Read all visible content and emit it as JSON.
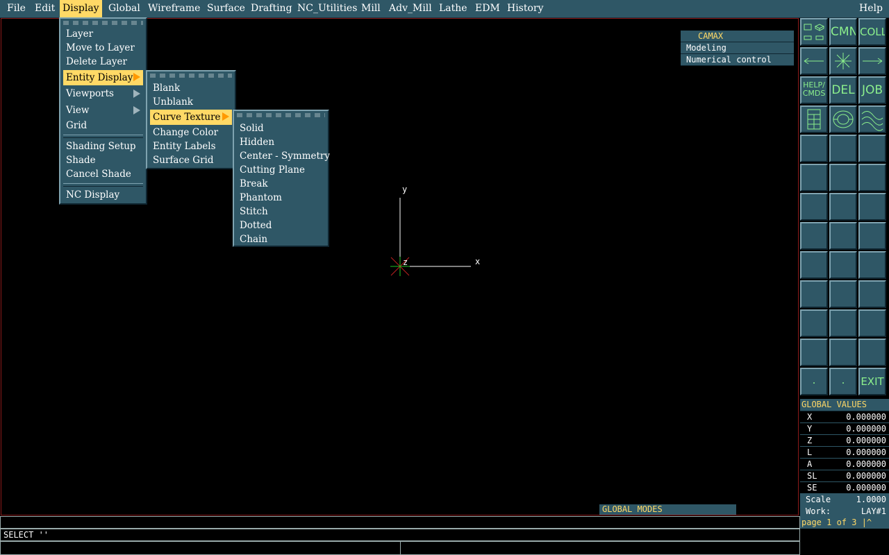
{
  "menubar": {
    "items": [
      "File",
      "Edit",
      "Display",
      "Global",
      "Wireframe",
      "Surface",
      "Drafting",
      "NC_Utilities",
      "Mill",
      "Adv_Mill",
      "Lathe",
      "EDM",
      "History"
    ],
    "help": "Help",
    "active": "Display"
  },
  "display_menu": {
    "items": [
      "Layer",
      "Move to Layer",
      "Delete Layer",
      "Entity Display",
      "Viewports",
      "View",
      "Grid",
      "Shading Setup",
      "Shade",
      "Cancel Shade",
      "NC Display"
    ],
    "highlighted": "Entity Display"
  },
  "entity_display_menu": {
    "items": [
      "Blank",
      "Unblank",
      "Curve Texture",
      "Change Color",
      "Entity Labels",
      "Surface Grid"
    ],
    "highlighted": "Curve Texture"
  },
  "curve_texture_menu": {
    "items": [
      "Solid",
      "Hidden",
      "Center - Symmetry",
      "Cutting Plane",
      "Break",
      "Phantom",
      "Stitch",
      "Dotted",
      "Chain"
    ]
  },
  "camax": {
    "title": "CAMAX",
    "rows": [
      "Modeling",
      "Numerical control"
    ]
  },
  "axes": {
    "x": "x",
    "y": "y",
    "z": "z"
  },
  "toolbar": {
    "cmn": "CMN",
    "coll": "COLL",
    "help_line1": "HELP/",
    "help_line2": "CMDS",
    "del": "DEL",
    "job": "JOB",
    "exit": "EXIT"
  },
  "global_values": {
    "title": "GLOBAL VALUES",
    "rows": [
      {
        "label": "X",
        "value": "0.000000"
      },
      {
        "label": "Y",
        "value": "0.000000"
      },
      {
        "label": "Z",
        "value": "0.000000"
      },
      {
        "label": "L",
        "value": "0.000000"
      },
      {
        "label": "A",
        "value": "0.000000"
      },
      {
        "label": "SL",
        "value": "0.000000"
      },
      {
        "label": "SE",
        "value": "0.000000"
      }
    ],
    "scale_label": "Scale",
    "scale_value": "1.0000",
    "work_label": "Work:",
    "work_value": "LAY#1"
  },
  "global_modes": "GLOBAL MODES",
  "command": {
    "prompt": "SELECT ''"
  },
  "page": "page 1 of 3 |^",
  "colors": {
    "panel": "#2f5766",
    "highlight": "#ffd966",
    "icon": "#8cf08c",
    "border": "#8b1a1a"
  }
}
